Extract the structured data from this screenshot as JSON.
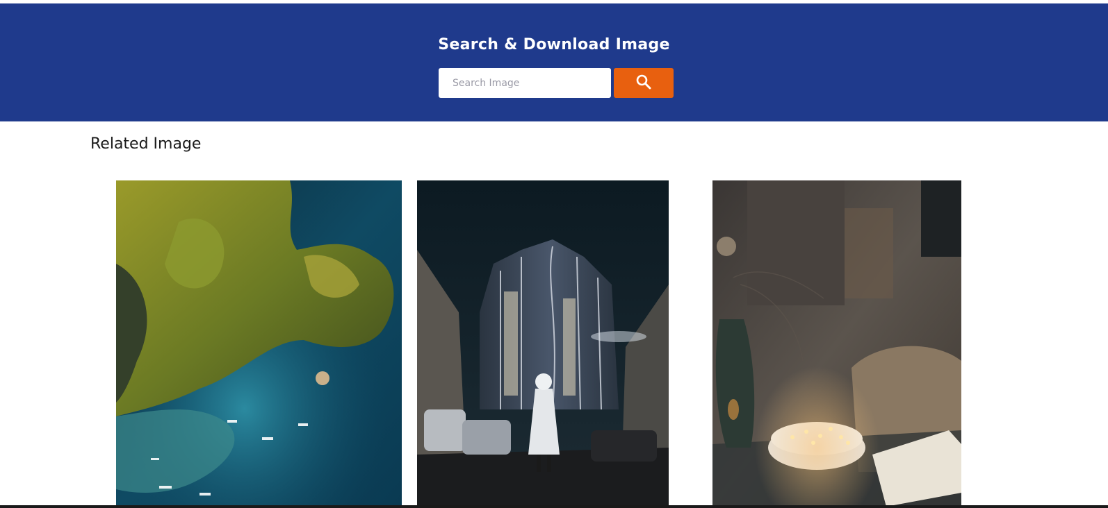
{
  "header": {
    "title": "Search & Download Image",
    "background_color": "#1f3a8c",
    "search": {
      "placeholder": "Search Image",
      "value": "",
      "button_icon": "search-icon",
      "button_color": "#e8600f"
    }
  },
  "related": {
    "title": "Related Image",
    "images": [
      {
        "subject": "aerial view of rocky island with boats in turquoise water"
      },
      {
        "subject": "person standing in street at night before illuminated skyscraper"
      },
      {
        "subject": "candles in white bowl on table with vase and open book"
      }
    ]
  }
}
